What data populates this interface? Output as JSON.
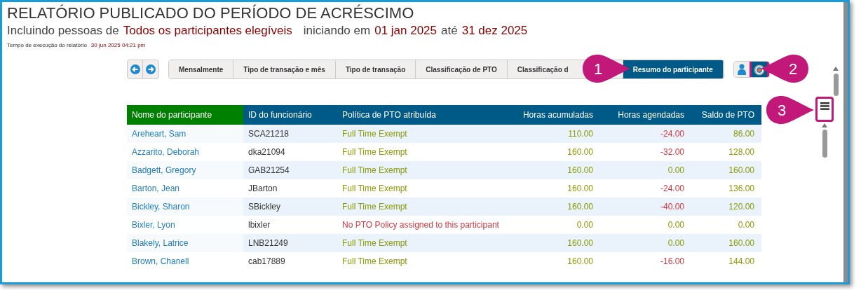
{
  "report": {
    "title": "RELATÓRIO PUBLICADO DO PERÍODO DE ACRÉSCIMO",
    "subtitle_parts": [
      {
        "text": "Incluindo pessoas de",
        "highlight": false
      },
      {
        "text": "Todos os participantes elegíveis",
        "highlight": true
      },
      {
        "text": "iniciando em",
        "highlight": false
      },
      {
        "text": "01 jan 2025",
        "highlight": true
      },
      {
        "text": "até",
        "highlight": false
      },
      {
        "text": "31 dez 2025",
        "highlight": true
      }
    ],
    "run_time_label": "Tempo de execução do relatório",
    "run_time": "30 jun 2025 04:21 pm"
  },
  "tabs": [
    {
      "label": "Mensalmente",
      "selected": false
    },
    {
      "label": "Tipo de transação e mês",
      "selected": false
    },
    {
      "label": "Tipo de transação",
      "selected": false
    },
    {
      "label": "Classificação de PTO",
      "selected": false
    },
    {
      "label": "Classificação d",
      "selected": false
    },
    {
      "label": "Resumo do participante",
      "selected": true
    }
  ],
  "view_toggle": [
    {
      "kind": "person",
      "selected": false
    },
    {
      "kind": "target",
      "selected": true
    }
  ],
  "callouts": [
    {
      "number": "1"
    },
    {
      "number": "2"
    },
    {
      "number": "3"
    }
  ],
  "table": {
    "columns": [
      {
        "label": "Nome do participante"
      },
      {
        "label": "ID do funcionário"
      },
      {
        "label": "Política de PTO atribuída"
      },
      {
        "label": "Horas acumuladas"
      },
      {
        "label": "Horas agendadas"
      },
      {
        "label": "Saldo de PTO"
      }
    ],
    "rows": [
      {
        "name": "Areheart, Sam",
        "id": "SCA21218",
        "policy": "Full Time Exempt",
        "policy_assigned": true,
        "accrued": "110.00",
        "scheduled": "-24.00",
        "scheduled_negative": true,
        "balance": "86.00"
      },
      {
        "name": "Azzarito, Deborah",
        "id": "dka21094",
        "policy": "Full Time Exempt",
        "policy_assigned": true,
        "accrued": "160.00",
        "scheduled": "-32.00",
        "scheduled_negative": true,
        "balance": "128.00"
      },
      {
        "name": "Badgett, Gregory",
        "id": "GAB21254",
        "policy": "Full Time Exempt",
        "policy_assigned": true,
        "accrued": "160.00",
        "scheduled": "0.00",
        "scheduled_negative": false,
        "balance": "160.00"
      },
      {
        "name": "Barton, Jean",
        "id": "JBarton",
        "policy": "Full Time Exempt",
        "policy_assigned": true,
        "accrued": "160.00",
        "scheduled": "-24.00",
        "scheduled_negative": true,
        "balance": "136.00"
      },
      {
        "name": "Bickley, Sharon",
        "id": "SBickley",
        "policy": "Full Time Exempt",
        "policy_assigned": true,
        "accrued": "160.00",
        "scheduled": "-40.00",
        "scheduled_negative": true,
        "balance": "120.00"
      },
      {
        "name": "Bixler, Lyon",
        "id": "lbixler",
        "policy": "No PTO Policy assigned to this participant",
        "policy_assigned": false,
        "accrued": "0.00",
        "scheduled": "0.00",
        "scheduled_negative": false,
        "balance": "0.00"
      },
      {
        "name": "Blakely, Latrice",
        "id": "LNB21249",
        "policy": "Full Time Exempt",
        "policy_assigned": true,
        "accrued": "160.00",
        "scheduled": "0.00",
        "scheduled_negative": false,
        "balance": "160.00"
      },
      {
        "name": "Brown, Chanell",
        "id": "cab17889",
        "policy": "Full Time Exempt",
        "policy_assigned": true,
        "accrued": "160.00",
        "scheduled": "-16.00",
        "scheduled_negative": true,
        "balance": "144.00"
      }
    ]
  }
}
